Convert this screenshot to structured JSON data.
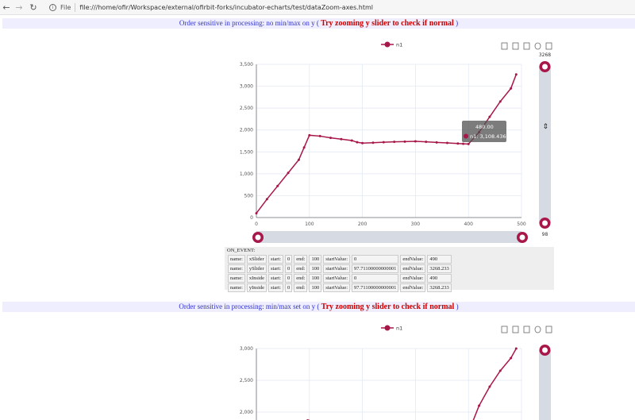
{
  "browser": {
    "back_icon": "arrow-left-icon",
    "forward_icon": "arrow-right-icon",
    "reload_icon": "reload-icon",
    "info_icon": "info-icon",
    "file_label": "File",
    "url": "file:///home/ofir/Workspace/external/ofirbit-forks/incubator-echarts/test/dataZoom-axes.html"
  },
  "section1": {
    "title_prefix": "Order sensitive in processing: no min/max on y (",
    "title_em": "Try zooming y slider to check if normal",
    "title_suffix": ")"
  },
  "section2": {
    "title_prefix": "Order sensitive in processing: min/max set on y (",
    "title_em": "Try zooming y slider to check if normal",
    "title_suffix": ")"
  },
  "toolbox_icons": [
    "data-view-icon",
    "zoom-icon",
    "zoom-reset-icon",
    "restore-icon",
    "save-image-icon"
  ],
  "chart_data": [
    {
      "type": "line",
      "legend": [
        "n1"
      ],
      "series": [
        {
          "name": "n1",
          "x": [
            0,
            20,
            40,
            60,
            80,
            90,
            100,
            120,
            140,
            160,
            180,
            190,
            200,
            220,
            240,
            260,
            280,
            300,
            320,
            340,
            360,
            380,
            390,
            400,
            420,
            440,
            460,
            480,
            490
          ],
          "y": [
            98,
            420,
            720,
            1020,
            1320,
            1600,
            1880,
            1860,
            1820,
            1790,
            1760,
            1720,
            1700,
            1710,
            1720,
            1730,
            1735,
            1740,
            1730,
            1715,
            1705,
            1690,
            1685,
            1680,
            1950,
            2300,
            2650,
            2950,
            3268
          ]
        }
      ],
      "xlim": [
        0,
        500
      ],
      "ylim": [
        0,
        3500
      ],
      "x_ticks": [
        "0",
        "100",
        "200",
        "300",
        "400",
        "500"
      ],
      "y_ticks": [
        "0",
        "500",
        "1,000",
        "1,500",
        "2,000",
        "2,500",
        "3,000",
        "3,500"
      ],
      "tooltip": {
        "title": "480.00",
        "text": "n1: 3,108.436"
      },
      "y_slider": {
        "top_label": "3268",
        "bottom_label": "98"
      },
      "grid": true
    },
    {
      "type": "line",
      "legend": [
        "n1"
      ],
      "series": [
        {
          "name": "n1",
          "x": [
            100,
            400,
            420,
            440,
            460,
            480,
            490
          ],
          "y": [
            1880,
            1680,
            2100,
            2400,
            2650,
            2850,
            3000
          ]
        }
      ],
      "xlim": [
        0,
        500
      ],
      "y_ticks": [
        "2,000",
        "2,500",
        "3,000"
      ],
      "grid": true
    }
  ],
  "on_event": {
    "title": "ON_EVENT:",
    "rows": [
      {
        "name_k": "name:",
        "name_v": "xSlider",
        "start_k": "start:",
        "start_v": "0",
        "end_k": "end:",
        "end_v": "100",
        "sv_k": "startValue:",
        "sv_v": "0",
        "ev_k": "endValue:",
        "ev_v": "490"
      },
      {
        "name_k": "name:",
        "name_v": "ySlider",
        "start_k": "start:",
        "start_v": "0",
        "end_k": "end:",
        "end_v": "100",
        "sv_k": "startValue:",
        "sv_v": "97.71100000000001",
        "ev_k": "endValue:",
        "ev_v": "3268.233"
      },
      {
        "name_k": "name:",
        "name_v": "xInside",
        "start_k": "start:",
        "start_v": "0",
        "end_k": "end:",
        "end_v": "100",
        "sv_k": "startValue:",
        "sv_v": "0",
        "ev_k": "endValue:",
        "ev_v": "490"
      },
      {
        "name_k": "name:",
        "name_v": "yInside",
        "start_k": "start:",
        "start_v": "0",
        "end_k": "end:",
        "end_v": "100",
        "sv_k": "startValue:",
        "sv_v": "97.71100000000001",
        "ev_k": "endValue:",
        "ev_v": "3268.233"
      }
    ]
  },
  "colors": {
    "series": "#a8174a",
    "slider_track": "#d6dae2",
    "grid": "#e0e6f1"
  }
}
